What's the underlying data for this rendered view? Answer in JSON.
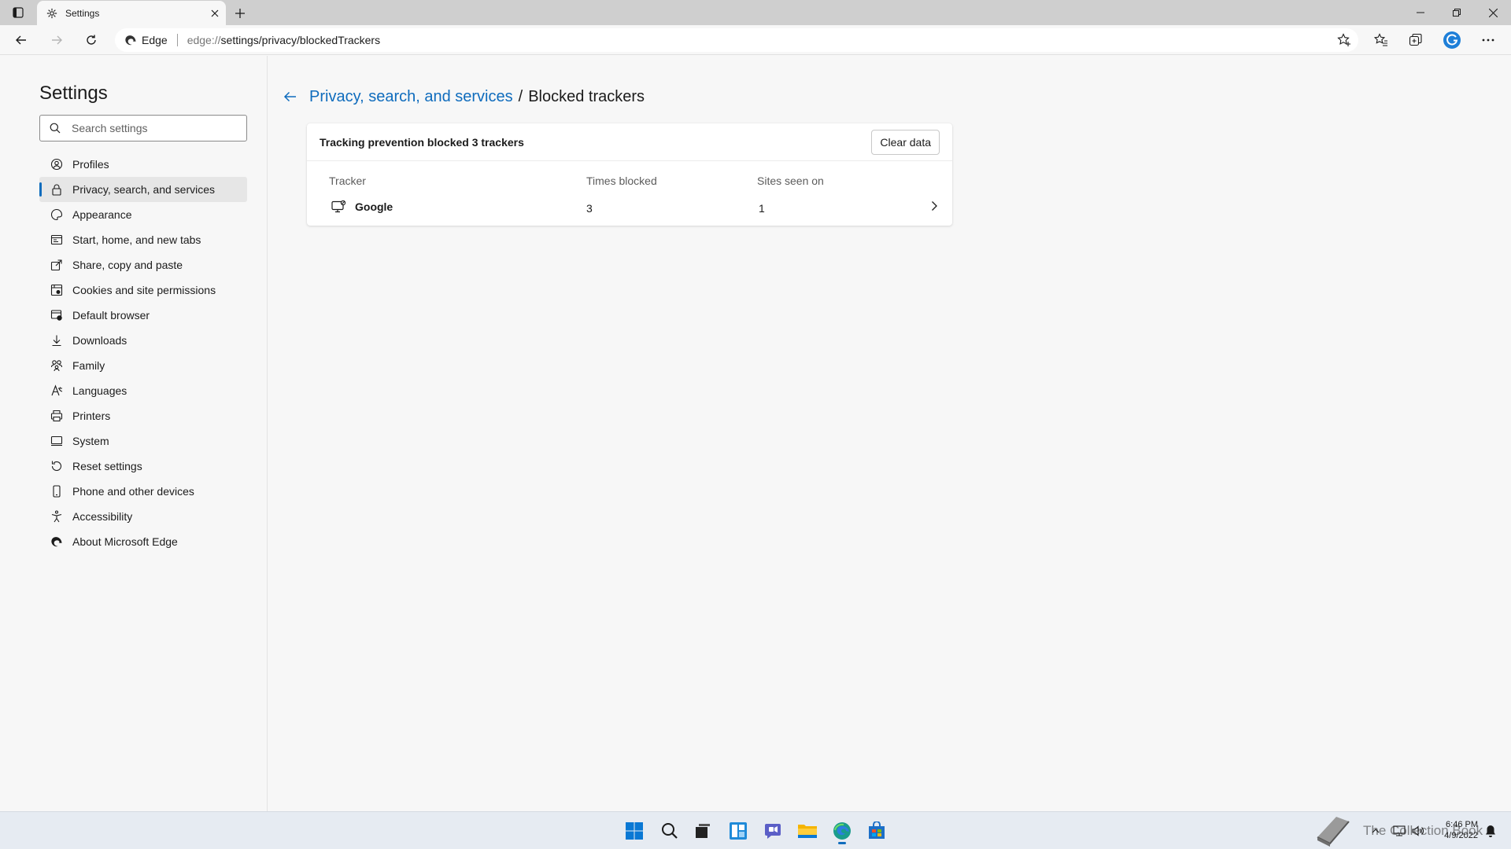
{
  "window": {
    "tab_title": "Settings",
    "site_name": "Edge",
    "url_prefix": "edge://",
    "url_path": "settings/privacy/blockedTrackers"
  },
  "sidebar": {
    "title": "Settings",
    "search_placeholder": "Search settings",
    "items": [
      {
        "label": "Profiles",
        "icon": "profile-icon"
      },
      {
        "label": "Privacy, search, and services",
        "icon": "lock-icon"
      },
      {
        "label": "Appearance",
        "icon": "appearance-icon"
      },
      {
        "label": "Start, home, and new tabs",
        "icon": "start-page-icon"
      },
      {
        "label": "Share, copy and paste",
        "icon": "share-icon"
      },
      {
        "label": "Cookies and site permissions",
        "icon": "cookies-icon"
      },
      {
        "label": "Default browser",
        "icon": "browser-icon"
      },
      {
        "label": "Downloads",
        "icon": "download-icon"
      },
      {
        "label": "Family",
        "icon": "family-icon"
      },
      {
        "label": "Languages",
        "icon": "languages-icon"
      },
      {
        "label": "Printers",
        "icon": "printer-icon"
      },
      {
        "label": "System",
        "icon": "system-icon"
      },
      {
        "label": "Reset settings",
        "icon": "reset-icon"
      },
      {
        "label": "Phone and other devices",
        "icon": "phone-icon"
      },
      {
        "label": "Accessibility",
        "icon": "accessibility-icon"
      },
      {
        "label": "About Microsoft Edge",
        "icon": "edge-logo-icon"
      }
    ],
    "active_index": 1
  },
  "main": {
    "breadcrumb_parent": "Privacy, search, and services",
    "breadcrumb_separator": "/",
    "breadcrumb_current": "Blocked trackers",
    "summary": "Tracking prevention blocked 3 trackers",
    "clear_button": "Clear data",
    "columns": {
      "tracker": "Tracker",
      "times_blocked": "Times blocked",
      "sites_seen": "Sites seen on"
    },
    "rows": [
      {
        "tracker": "Google",
        "times_blocked": "3",
        "sites_seen": "1"
      }
    ]
  },
  "taskbar": {
    "apps": [
      "start-icon",
      "search-icon",
      "task-view-icon",
      "widgets-icon",
      "chat-icon",
      "file-explorer-icon",
      "edge-icon",
      "store-icon"
    ],
    "time": "6:46 PM",
    "date": "4/9/2022",
    "watermark": "The Collection Book"
  },
  "colors": {
    "accent": "#0f6cbd",
    "link": "#0f6cbd"
  }
}
